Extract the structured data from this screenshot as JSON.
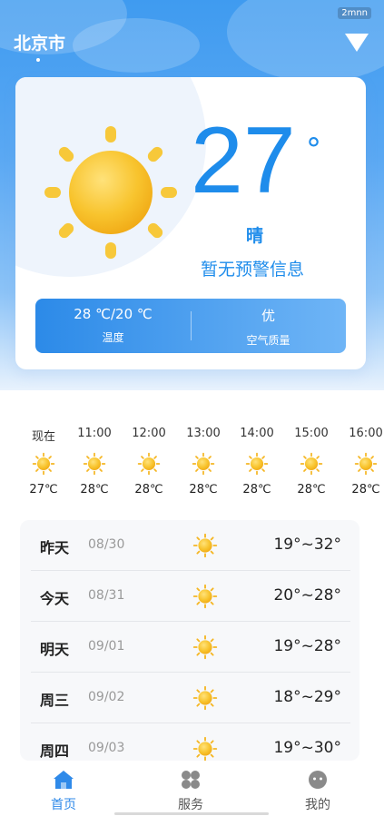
{
  "status": {
    "badge": "2mnn"
  },
  "header": {
    "city": "北京市"
  },
  "current": {
    "temperature": "27",
    "degree_symbol": "°",
    "condition": "晴",
    "alert": "暂无预警信息",
    "icon": "sun-icon",
    "range_value": "28 ℃/20 ℃",
    "range_label": "温度",
    "aqi_value": "优",
    "aqi_label": "空气质量"
  },
  "hourly": [
    {
      "time": "现在",
      "temp": "27℃",
      "icon": "sun-icon"
    },
    {
      "time": "11:00",
      "temp": "28℃",
      "icon": "sun-icon"
    },
    {
      "time": "12:00",
      "temp": "28℃",
      "icon": "sun-icon"
    },
    {
      "time": "13:00",
      "temp": "28℃",
      "icon": "sun-icon"
    },
    {
      "time": "14:00",
      "temp": "28℃",
      "icon": "sun-icon"
    },
    {
      "time": "15:00",
      "temp": "28℃",
      "icon": "sun-icon"
    },
    {
      "time": "16:00",
      "temp": "28℃",
      "icon": "sun-icon"
    }
  ],
  "daily": [
    {
      "day": "昨天",
      "date": "08/30",
      "range": "19°~32°",
      "icon": "sun-icon"
    },
    {
      "day": "今天",
      "date": "08/31",
      "range": "20°~28°",
      "icon": "sun-icon"
    },
    {
      "day": "明天",
      "date": "09/01",
      "range": "19°~28°",
      "icon": "sun-icon"
    },
    {
      "day": "周三",
      "date": "09/02",
      "range": "18°~29°",
      "icon": "sun-icon"
    },
    {
      "day": "周四",
      "date": "09/03",
      "range": "19°~30°",
      "icon": "sun-icon"
    }
  ],
  "tabs": [
    {
      "label": "首页",
      "icon": "home-icon",
      "active": true
    },
    {
      "label": "服务",
      "icon": "grid-icon",
      "active": false
    },
    {
      "label": "我的",
      "icon": "profile-icon",
      "active": false
    }
  ],
  "colors": {
    "accent": "#1e8ceb",
    "tab_active": "#2f8ae9",
    "sun": "#f7c02e"
  }
}
